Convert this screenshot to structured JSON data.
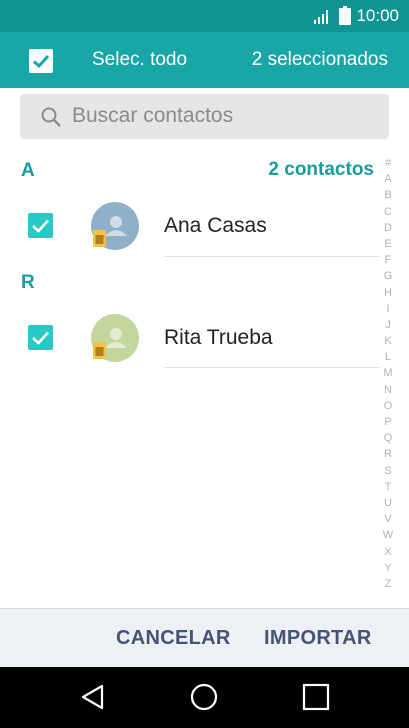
{
  "status_bar": {
    "time": "10:00",
    "signal_icon": "signal-icon",
    "battery_icon": "battery-icon"
  },
  "toolbar": {
    "select_all_label": "Selec. todo",
    "selected_count": "2 seleccionados",
    "select_all_checked": true
  },
  "search": {
    "placeholder": "Buscar contactos",
    "value": ""
  },
  "contacts_count": "2 contactos",
  "sections": [
    {
      "letter": "A",
      "contacts": [
        {
          "name": "Ana Casas",
          "checked": true,
          "avatar_color": "#8fb0c6"
        }
      ]
    },
    {
      "letter": "R",
      "contacts": [
        {
          "name": "Rita Trueba",
          "checked": true,
          "avatar_color": "#c3d69e"
        }
      ]
    }
  ],
  "index_letters": [
    "#",
    "A",
    "B",
    "C",
    "D",
    "E",
    "F",
    "G",
    "H",
    "I",
    "J",
    "K",
    "L",
    "M",
    "N",
    "O",
    "P",
    "Q",
    "R",
    "S",
    "T",
    "U",
    "V",
    "W",
    "X",
    "Y",
    "Z"
  ],
  "actions": {
    "cancel_label": "CANCELAR",
    "import_label": "IMPORTAR"
  },
  "colors": {
    "status_bar": "#0f9494",
    "toolbar": "#18a7a6",
    "accent": "#189d9c",
    "checkbox": "#2bc7c5",
    "action_text": "#465373"
  }
}
